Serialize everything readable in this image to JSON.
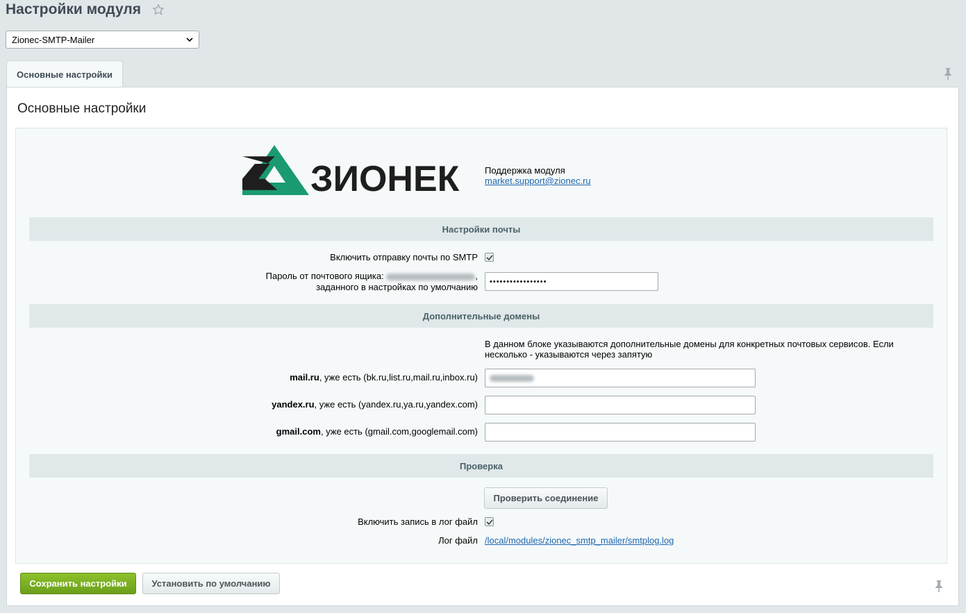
{
  "header": {
    "title": "Настройки модуля",
    "module_selected": "Zionec-SMTP-Mailer"
  },
  "tabs": [
    {
      "label": "Основные настройки"
    }
  ],
  "section": {
    "title": "Основные настройки"
  },
  "brand": {
    "logo_text": "ЗИОНЕК",
    "support_label": "Поддержка модуля",
    "support_email": "market.support@zionec.ru",
    "accent_color": "#1a9a73",
    "dark_color": "#1e1e1e"
  },
  "mail_settings": {
    "heading": "Настройки почты",
    "smtp_label": "Включить отправку почты по SMTP",
    "smtp_enabled": true,
    "password_label_prefix": "Пароль от почтового ящика:",
    "password_label_suffix": ",",
    "password_label_line2": "заданного в настройках по умолчанию",
    "password_value": "•••••••••••••••••"
  },
  "domains": {
    "heading": "Дополнительные домены",
    "hint": "В данном блоке указываются дополнительные домены для конкретных почтовых сервисов. Если несколько - указываются через запятую",
    "rows": [
      {
        "service": "mail.ru",
        "existing": ", уже есть (bk.ru,list.ru,mail.ru,inbox.ru)",
        "value": ""
      },
      {
        "service": "yandex.ru",
        "existing": ", уже есть (yandex.ru,ya.ru,yandex.com)",
        "value": ""
      },
      {
        "service": "gmail.com",
        "existing": ", уже есть (gmail.com,googlemail.com)",
        "value": ""
      }
    ]
  },
  "check": {
    "heading": "Проверка",
    "button_label": "Проверить соединение",
    "log_label": "Включить запись в лог файл",
    "log_enabled": true,
    "log_file_label": "Лог файл",
    "log_file_path": "/local/modules/zionec_smtp_mailer/smtplog.log"
  },
  "footer": {
    "save_label": "Сохранить настройки",
    "default_label": "Установить по умолчанию"
  }
}
